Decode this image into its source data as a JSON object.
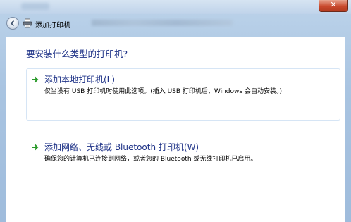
{
  "window": {
    "close_glyph": "✕"
  },
  "nav": {
    "title": "添加打印机",
    "back_icon": "back-arrow-icon",
    "printer_icon": "printer-icon"
  },
  "main": {
    "question": "要安装什么类型的打印机?",
    "options": [
      {
        "title": "添加本地打印机(L)",
        "description": "仅当没有 USB 打印机时使用此选项。(插入 USB 打印机后，Windows 会自动安装。)",
        "icon": "green-arrow-icon"
      },
      {
        "title": "添加网络、无线或 Bluetooth 打印机(W)",
        "description": "确保您的计算机已连接到网络，或者您的 Bluetooth 或无线打印机已启用。",
        "icon": "green-arrow-icon"
      }
    ]
  },
  "colors": {
    "link_blue": "#1e3287",
    "arrow_green": "#2a9a2a",
    "panel_border": "#8aa2bd"
  }
}
